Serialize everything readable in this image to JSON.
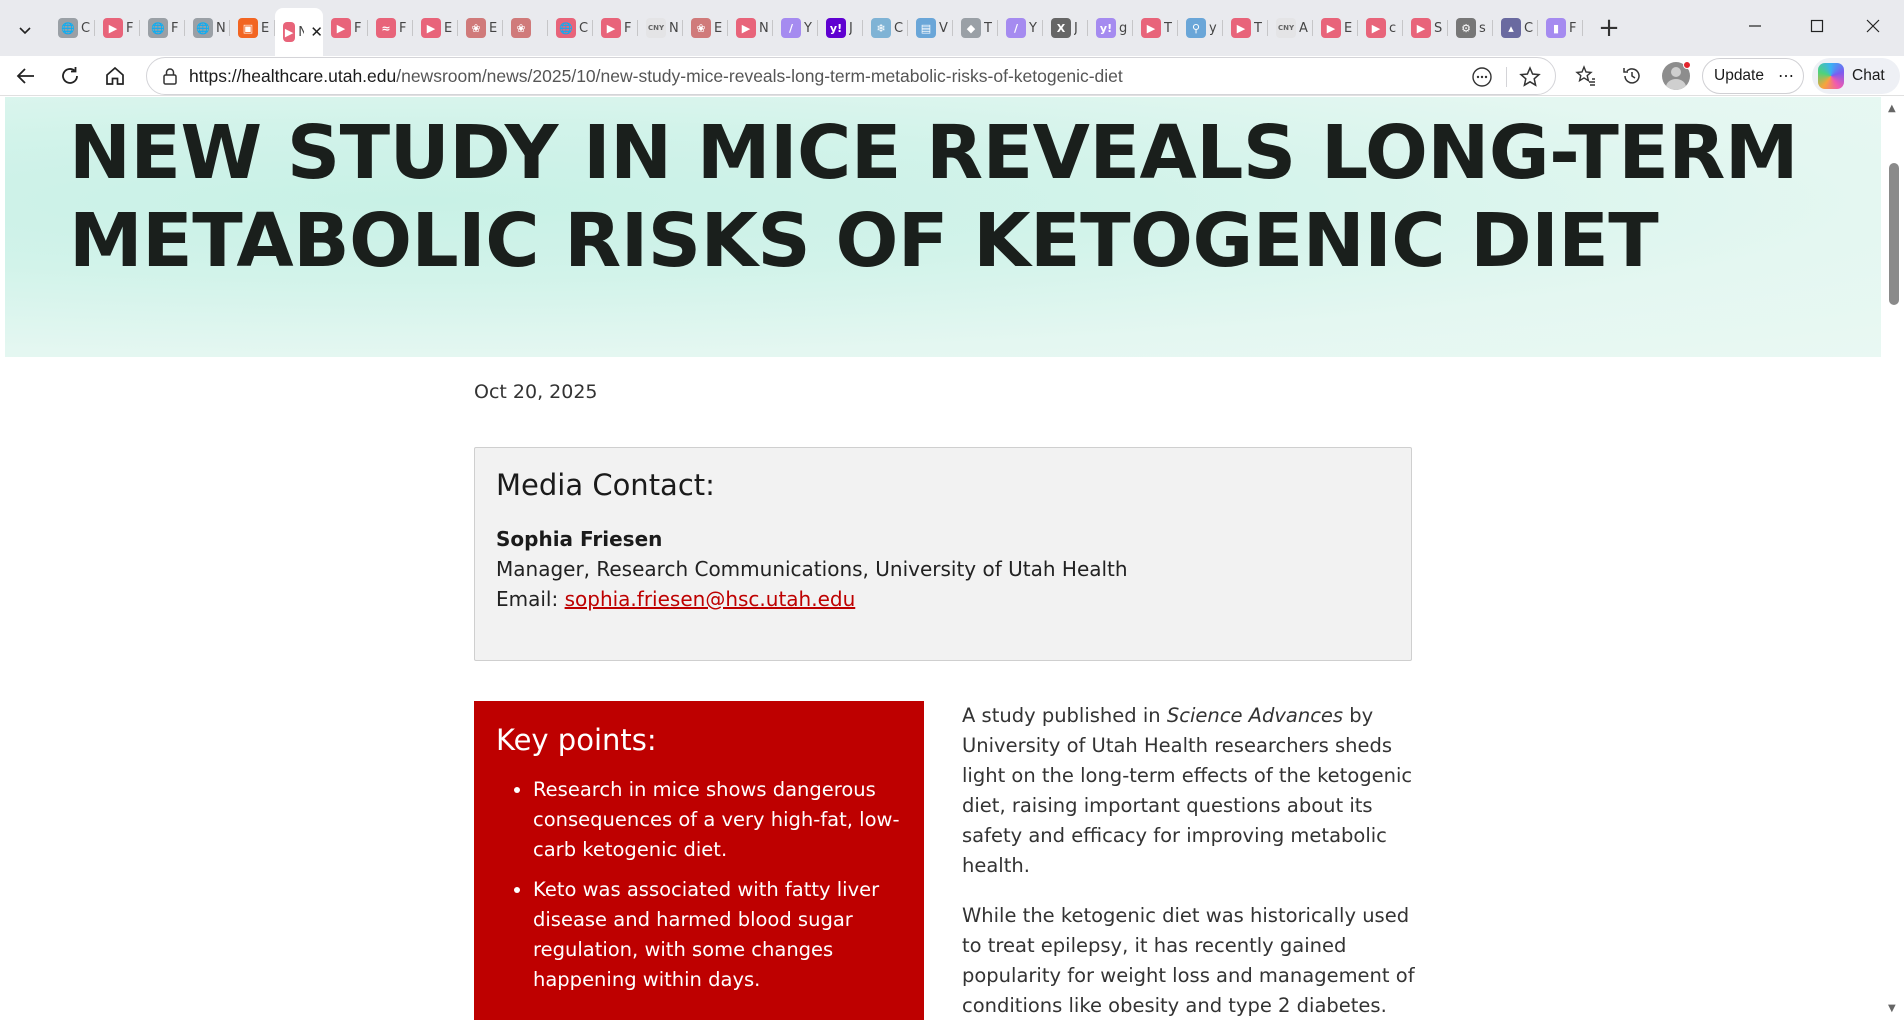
{
  "browser": {
    "tabs": [
      {
        "icon": "globe-icon",
        "label": "C",
        "color": "#9aa0a6"
      },
      {
        "icon": "youtube-icon",
        "label": "F",
        "color": "#e8647a"
      },
      {
        "icon": "globe-icon",
        "label": "F",
        "color": "#9aa0a6"
      },
      {
        "icon": "globe-icon",
        "label": "N",
        "color": "#9aa0a6"
      },
      {
        "icon": "bookmark-icon",
        "label": "E",
        "color": "#f26522"
      },
      {
        "icon": "youtube-icon",
        "label": "N",
        "color": "#e8647a"
      },
      {
        "icon": "youtube-icon",
        "label": "F",
        "color": "#e8647a"
      },
      {
        "icon": "wifi-icon",
        "label": "F",
        "color": "#e8647a"
      },
      {
        "icon": "youtube-icon",
        "label": "E",
        "color": "#e8647a"
      },
      {
        "icon": "emblem-icon",
        "label": "E",
        "color": "#d07a7a"
      },
      {
        "icon": "emblem-icon",
        "label": "",
        "color": "#d07a7a"
      },
      {
        "icon": "globe-icon",
        "label": "C",
        "color": "#e8647a"
      },
      {
        "icon": "youtube-icon",
        "label": "F",
        "color": "#e8647a"
      },
      {
        "icon": "cny-icon",
        "label": "N",
        "color": "#9aa0a6"
      },
      {
        "icon": "emblem-icon",
        "label": "E",
        "color": "#d07a7a"
      },
      {
        "icon": "youtube-icon",
        "label": "N",
        "color": "#e8647a"
      },
      {
        "icon": "slash-icon",
        "label": "Y",
        "color": "#a58bf0"
      },
      {
        "icon": "yahoo-icon",
        "label": "J",
        "color": "#5f01d1"
      },
      {
        "icon": "snowflake-icon",
        "label": "C",
        "color": "#7fb3d5"
      },
      {
        "icon": "doc-icon",
        "label": "V",
        "color": "#6aa6d8"
      },
      {
        "icon": "diamond-icon",
        "label": "T",
        "color": "#9aa0a6"
      },
      {
        "icon": "slash-icon",
        "label": "Y",
        "color": "#a58bf0"
      },
      {
        "icon": "x-icon",
        "label": "J",
        "color": "#666"
      },
      {
        "icon": "yahoo-icon",
        "label": "g",
        "color": "#a58bf0"
      },
      {
        "icon": "youtube-icon",
        "label": "T",
        "color": "#e8647a"
      },
      {
        "icon": "search-icon",
        "label": "y",
        "color": "#6aa6d8"
      },
      {
        "icon": "youtube-icon",
        "label": "T",
        "color": "#e8647a"
      },
      {
        "icon": "cny-icon",
        "label": "A",
        "color": "#9aa0a6"
      },
      {
        "icon": "youtube-icon",
        "label": "E",
        "color": "#e8647a"
      },
      {
        "icon": "youtube-icon",
        "label": "c",
        "color": "#e8647a"
      },
      {
        "icon": "youtube-icon",
        "label": "S",
        "color": "#e8647a"
      },
      {
        "icon": "settings-icon",
        "label": "s",
        "color": "#777"
      },
      {
        "icon": "chart-icon",
        "label": "C",
        "color": "#6a6aa0"
      },
      {
        "icon": "pdf-icon",
        "label": "F",
        "color": "#a58bf0"
      }
    ],
    "url_domain": "https://healthcare.utah.edu",
    "url_path": "/newsroom/news/2025/10/new-study-mice-reveals-long-term-metabolic-risks-of-ketogenic-diet",
    "update_label": "Update",
    "chat_label": "Chat"
  },
  "article": {
    "title": "NEW STUDY IN MICE REVEALS LONG-TERM METABOLIC RISKS OF KETOGENIC DIET",
    "date": "Oct 20, 2025",
    "media_contact": {
      "heading": "Media Contact:",
      "name": "Sophia Friesen",
      "role": "Manager, Research Communications, University of Utah Health",
      "email_label": "Email:",
      "email": "sophia.friesen@hsc.utah.edu"
    },
    "key_points": {
      "heading": "Key points:",
      "items": [
        "Research in mice shows dangerous consequences of a very high-fat, low-carb ketogenic diet.",
        "Keto was associated with fatty liver disease and harmed blood sugar regulation, with some changes happening within days."
      ]
    },
    "paragraphs": {
      "p1_before": "A study published in ",
      "p1_journal": "Science Advances",
      "p1_after": " by University of Utah Health researchers sheds light on the long-term effects of the ketogenic diet, raising important questions about its safety and efficacy for improving metabolic health.",
      "p2": "While the ketogenic diet was historically used to treat epilepsy, it has recently gained popularity for weight loss and management of conditions like obesity and type 2 diabetes."
    },
    "colors": {
      "accent_red": "#be0000",
      "hero_mint": "#d2f3ea"
    }
  }
}
